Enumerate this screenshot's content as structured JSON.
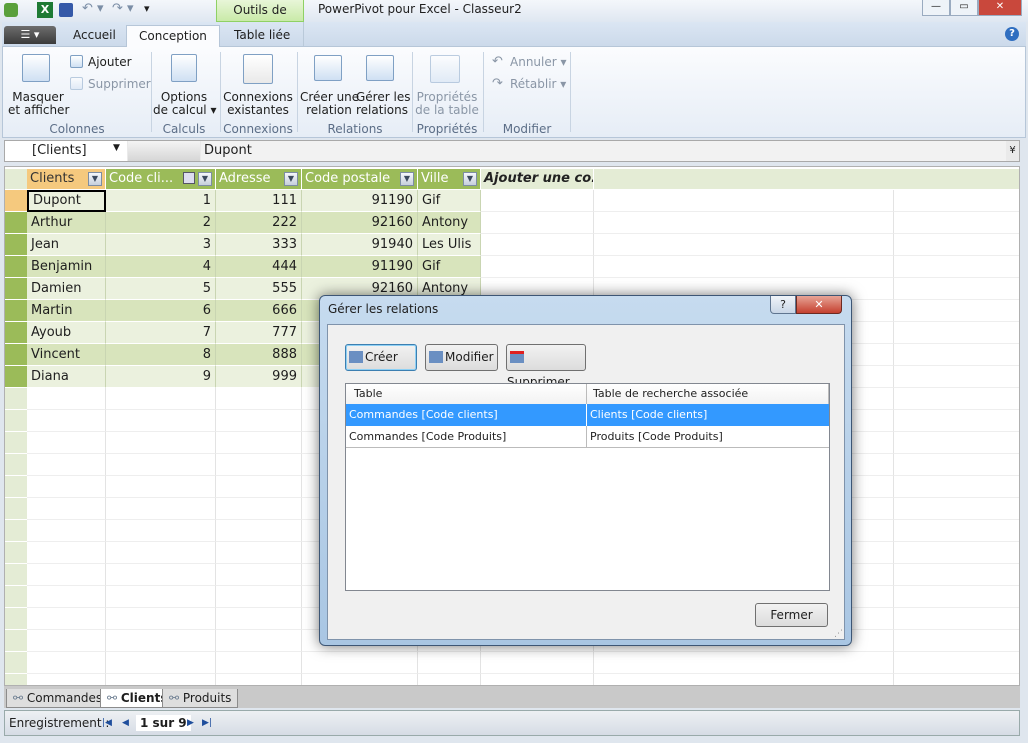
{
  "window": {
    "title": "PowerPivot pour Excel - Classeur2",
    "context_tab": "Outils de table",
    "minimize": "—",
    "restore": "▭",
    "close": "✕",
    "help": "?"
  },
  "ribbon": {
    "tabs": [
      {
        "label": "Accueil"
      },
      {
        "label": "Conception",
        "active": true
      },
      {
        "label": "Table liée"
      }
    ],
    "buttons": {
      "masquer": "Masquer\net afficher",
      "ajouter": "Ajouter",
      "supprimer": "Supprimer",
      "options": "Options\nde calcul ▾",
      "connexions": "Connexions\nexistantes",
      "creer_relation": "Créer une\nrelation",
      "gerer_relations": "Gérer les\nrelations",
      "proprietes": "Propriétés\nde la table",
      "annuler": "Annuler ▾",
      "retablir": "Rétablir ▾"
    },
    "groups": [
      "Colonnes",
      "Calculs",
      "Connexions",
      "Relations",
      "Propriétés",
      "Modifier"
    ]
  },
  "formula_bar": {
    "name_box": "[Clients]",
    "value": "Dupont"
  },
  "grid": {
    "columns": [
      "Clients",
      "Code cli...",
      "Adresse",
      "Code postale",
      "Ville",
      "Ajouter une co..."
    ],
    "rows": [
      [
        "Dupont",
        "1",
        "111",
        "91190",
        "Gif"
      ],
      [
        "Arthur",
        "2",
        "222",
        "92160",
        "Antony"
      ],
      [
        "Jean",
        "3",
        "333",
        "91940",
        "Les Ulis"
      ],
      [
        "Benjamin",
        "4",
        "444",
        "91190",
        "Gif"
      ],
      [
        "Damien",
        "5",
        "555",
        "92160",
        "Antony"
      ],
      [
        "Martin",
        "6",
        "666",
        "",
        ""
      ],
      [
        "Ayoub",
        "7",
        "777",
        "",
        ""
      ],
      [
        "Vincent",
        "8",
        "888",
        "",
        ""
      ],
      [
        "Diana",
        "9",
        "999",
        "",
        ""
      ]
    ],
    "header_color": "#9bbb59",
    "selected_cell": "Dupont"
  },
  "sheet_tabs": [
    {
      "label": "Commandes"
    },
    {
      "label": "Clients",
      "active": true
    },
    {
      "label": "Produits"
    }
  ],
  "status": {
    "label": "Enregistrement :",
    "position": "1 sur 9"
  },
  "dialog": {
    "title": "Gérer les relations",
    "help": "?",
    "close": "✕",
    "buttons": {
      "creer": "Créer",
      "modifier": "Modifier",
      "supprimer": "Supprimer",
      "fermer": "Fermer"
    },
    "columns": [
      "Table",
      "Table de recherche associée"
    ],
    "rows": [
      [
        "Commandes [Code clients]",
        "Clients [Code clients]"
      ],
      [
        "Commandes [Code Produits]",
        "Produits [Code Produits]"
      ]
    ],
    "selected_color": "#3399ff"
  }
}
